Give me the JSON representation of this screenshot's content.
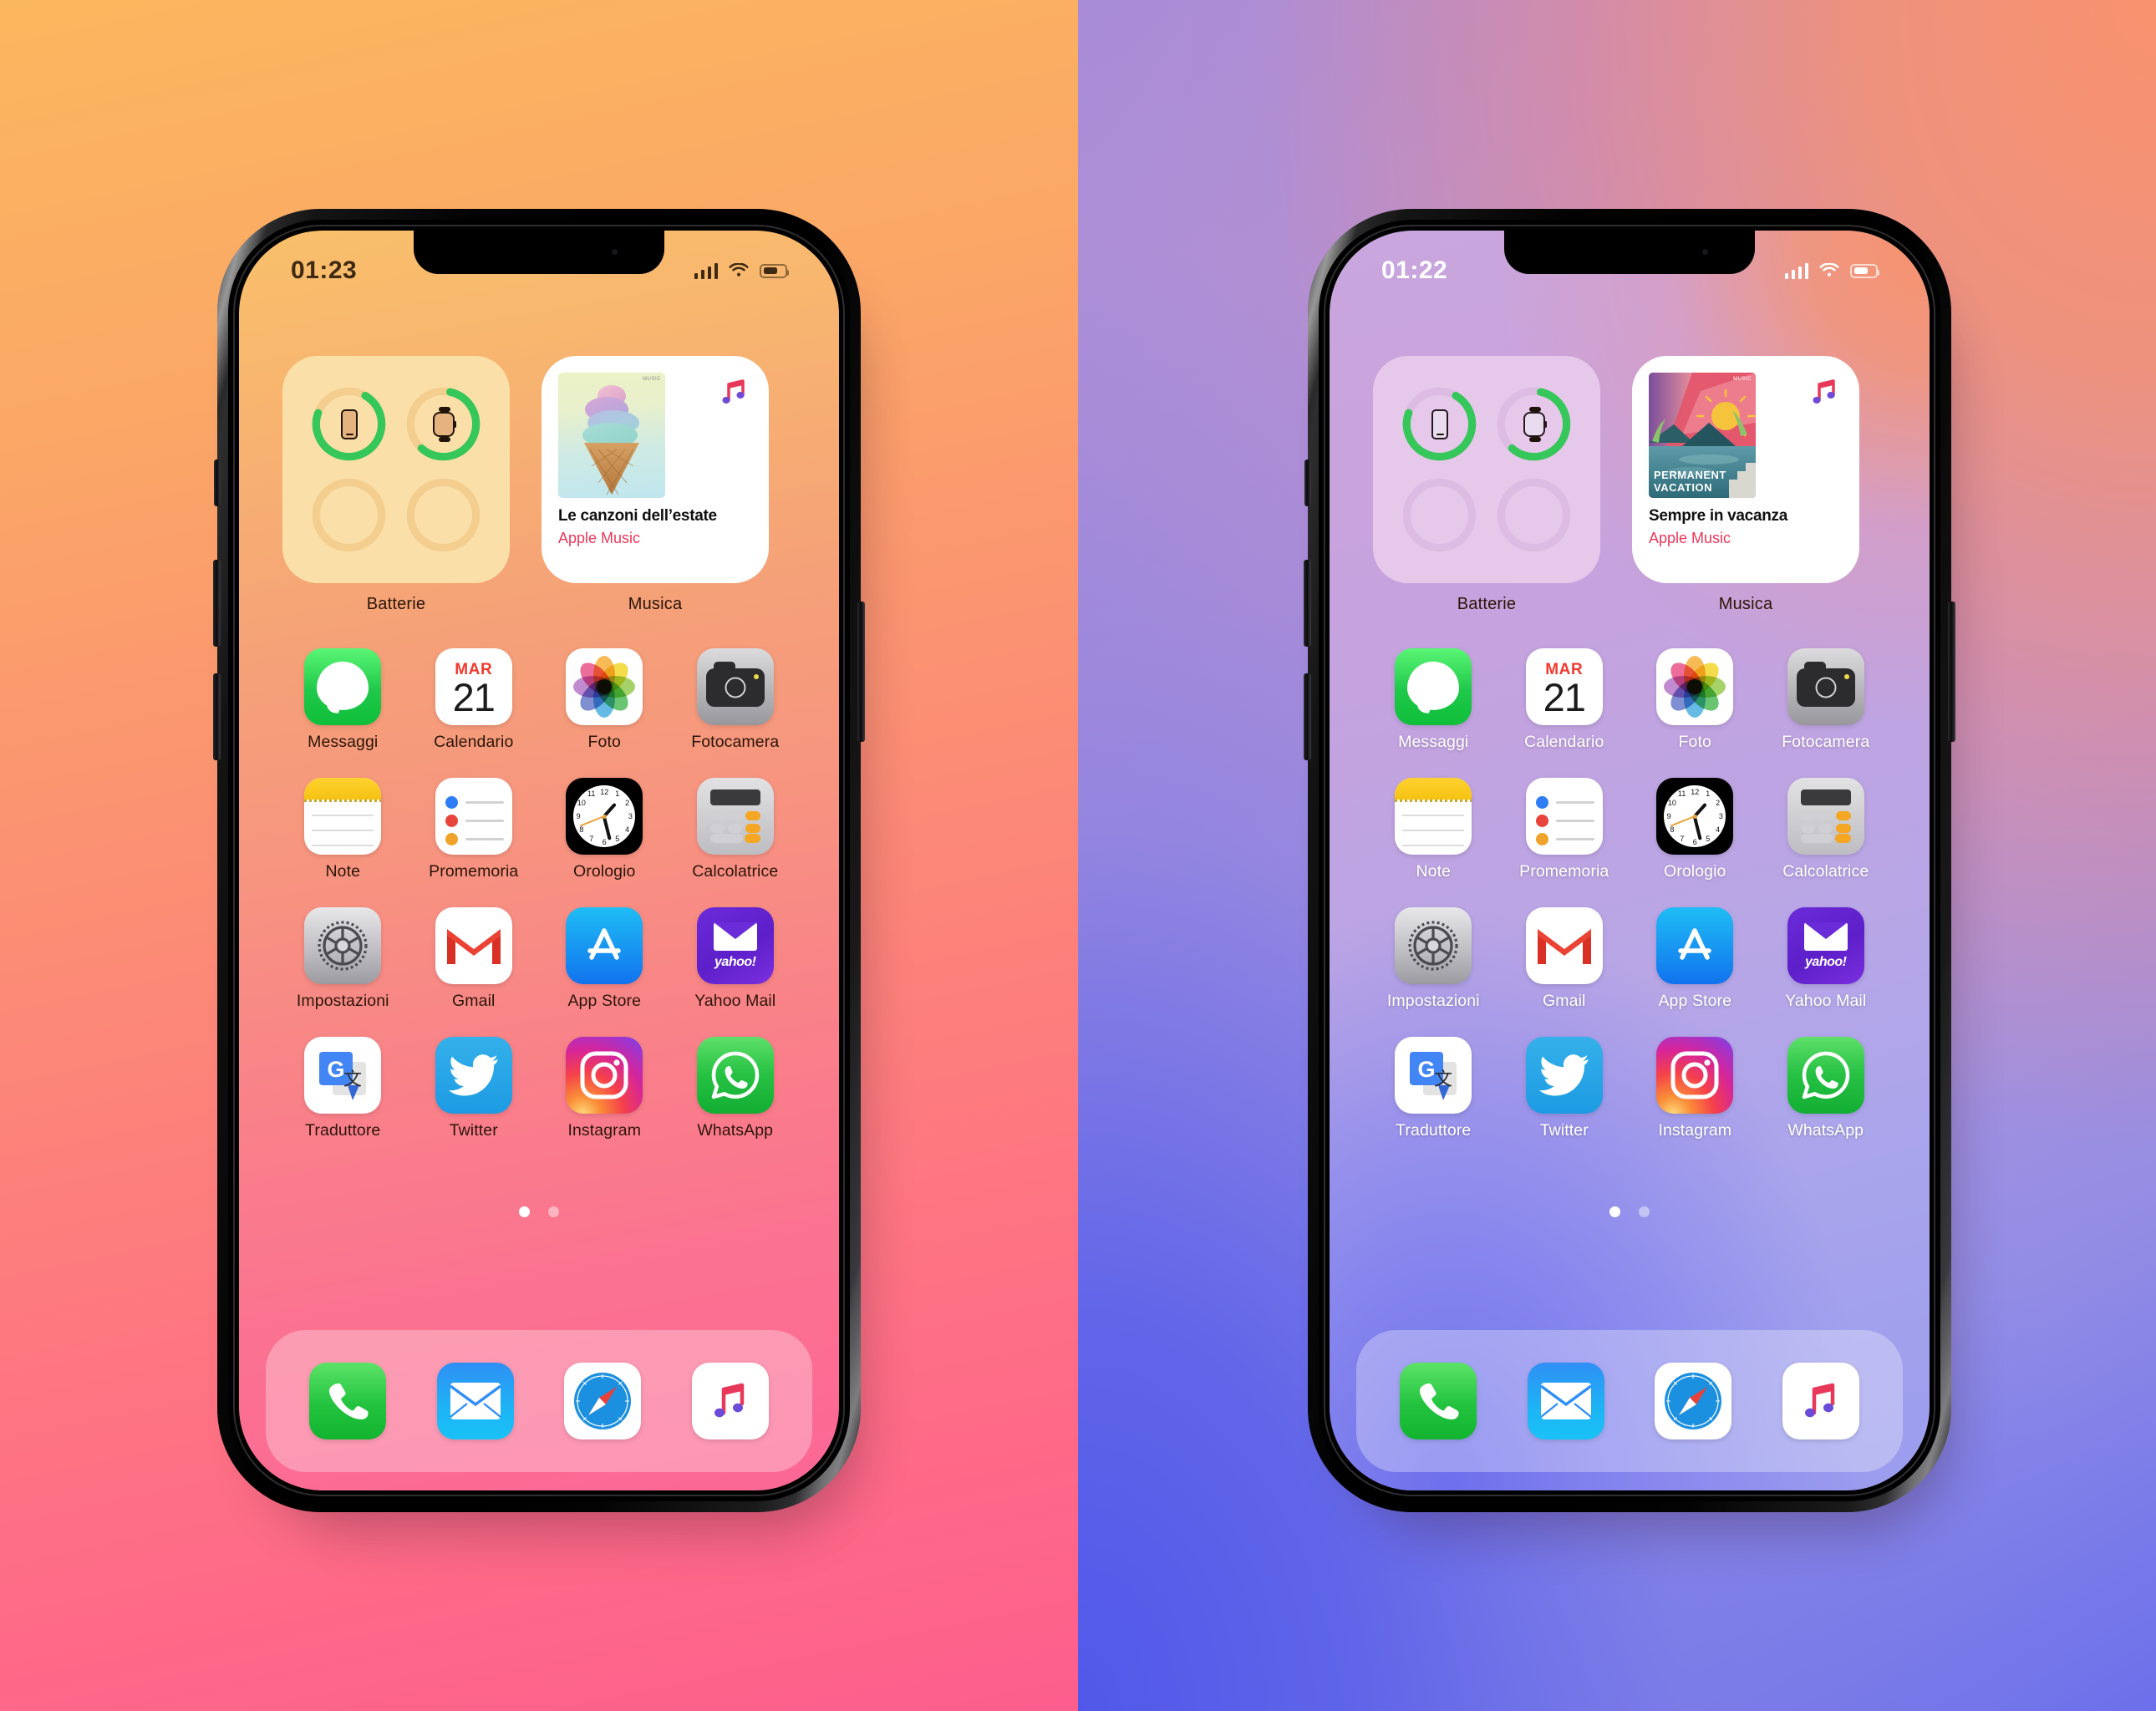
{
  "panels": [
    {
      "id": "left",
      "status": {
        "time": "01:23",
        "signal_bars": 4,
        "wifi": true,
        "battery_percent": 68
      },
      "widgets": {
        "battery": {
          "label": "Batterie",
          "rings": [
            {
              "device": "phone-icon",
              "percent": 72
            },
            {
              "device": "watch-icon",
              "percent": 58
            },
            {
              "device": "empty",
              "percent": 0
            },
            {
              "device": "empty",
              "percent": 0
            }
          ]
        },
        "music": {
          "label": "Musica",
          "title": "Le canzoni dell’estate",
          "subtitle": "Apple Music",
          "art": "ice-cream-cone",
          "art_badge": "MUSIC"
        }
      },
      "apps": [
        {
          "label": "Messaggi",
          "icon": "messages-icon"
        },
        {
          "label": "Calendario",
          "icon": "calendar-icon",
          "month": "MAR",
          "day": "21"
        },
        {
          "label": "Foto",
          "icon": "photos-icon"
        },
        {
          "label": "Fotocamera",
          "icon": "camera-icon"
        },
        {
          "label": "Note",
          "icon": "notes-icon"
        },
        {
          "label": "Promemoria",
          "icon": "reminders-icon"
        },
        {
          "label": "Orologio",
          "icon": "clock-icon"
        },
        {
          "label": "Calcolatrice",
          "icon": "calculator-icon"
        },
        {
          "label": "Impostazioni",
          "icon": "settings-icon"
        },
        {
          "label": "Gmail",
          "icon": "gmail-icon"
        },
        {
          "label": "App Store",
          "icon": "appstore-icon"
        },
        {
          "label": "Yahoo Mail",
          "icon": "yahoo-mail-icon"
        },
        {
          "label": "Traduttore",
          "icon": "google-translate-icon"
        },
        {
          "label": "Twitter",
          "icon": "twitter-icon"
        },
        {
          "label": "Instagram",
          "icon": "instagram-icon"
        },
        {
          "label": "WhatsApp",
          "icon": "whatsapp-icon"
        }
      ],
      "page_dots": {
        "count": 2,
        "active": 0
      },
      "dock": [
        {
          "label": "Telefono",
          "icon": "phone-icon"
        },
        {
          "label": "Mail",
          "icon": "mail-icon"
        },
        {
          "label": "Safari",
          "icon": "safari-icon"
        },
        {
          "label": "Musica",
          "icon": "music-icon"
        }
      ]
    },
    {
      "id": "right",
      "status": {
        "time": "01:22",
        "signal_bars": 4,
        "wifi": true,
        "battery_percent": 68
      },
      "widgets": {
        "battery": {
          "label": "Batterie",
          "rings": [
            {
              "device": "phone-icon",
              "percent": 72
            },
            {
              "device": "watch-icon",
              "percent": 58
            },
            {
              "device": "empty",
              "percent": 0
            },
            {
              "device": "empty",
              "percent": 0
            }
          ]
        },
        "music": {
          "label": "Musica",
          "title": "Sempre in vacanza",
          "subtitle": "Apple Music",
          "art": "permanent-vacation-sunset",
          "art_badge": "MUSIC",
          "art_text_line1": "PERMANENT",
          "art_text_line2": "VACATION"
        }
      },
      "apps": [
        {
          "label": "Messaggi",
          "icon": "messages-icon"
        },
        {
          "label": "Calendario",
          "icon": "calendar-icon",
          "month": "MAR",
          "day": "21"
        },
        {
          "label": "Foto",
          "icon": "photos-icon"
        },
        {
          "label": "Fotocamera",
          "icon": "camera-icon"
        },
        {
          "label": "Note",
          "icon": "notes-icon"
        },
        {
          "label": "Promemoria",
          "icon": "reminders-icon"
        },
        {
          "label": "Orologio",
          "icon": "clock-icon"
        },
        {
          "label": "Calcolatrice",
          "icon": "calculator-icon"
        },
        {
          "label": "Impostazioni",
          "icon": "settings-icon"
        },
        {
          "label": "Gmail",
          "icon": "gmail-icon"
        },
        {
          "label": "App Store",
          "icon": "appstore-icon"
        },
        {
          "label": "Yahoo Mail",
          "icon": "yahoo-mail-icon"
        },
        {
          "label": "Traduttore",
          "icon": "google-translate-icon"
        },
        {
          "label": "Twitter",
          "icon": "twitter-icon"
        },
        {
          "label": "Instagram",
          "icon": "instagram-icon"
        },
        {
          "label": "WhatsApp",
          "icon": "whatsapp-icon"
        }
      ],
      "page_dots": {
        "count": 2,
        "active": 0
      },
      "dock": [
        {
          "label": "Telefono",
          "icon": "phone-icon"
        },
        {
          "label": "Mail",
          "icon": "mail-icon"
        },
        {
          "label": "Safari",
          "icon": "safari-icon"
        },
        {
          "label": "Musica",
          "icon": "music-icon"
        }
      ]
    }
  ],
  "colors": {
    "ring_green": "#35C759",
    "apple_music_red": "#E8385A",
    "calendar_red": "#F0392F",
    "left_bg_top": "#FBB75E",
    "left_bg_bottom": "#FD5E8D",
    "right_bg_topright": "#F9926E",
    "right_bg_bottomleft": "#5158E9"
  },
  "clock_numerals": [
    "12",
    "1",
    "2",
    "3",
    "4",
    "5",
    "6",
    "7",
    "8",
    "9",
    "10",
    "11"
  ]
}
